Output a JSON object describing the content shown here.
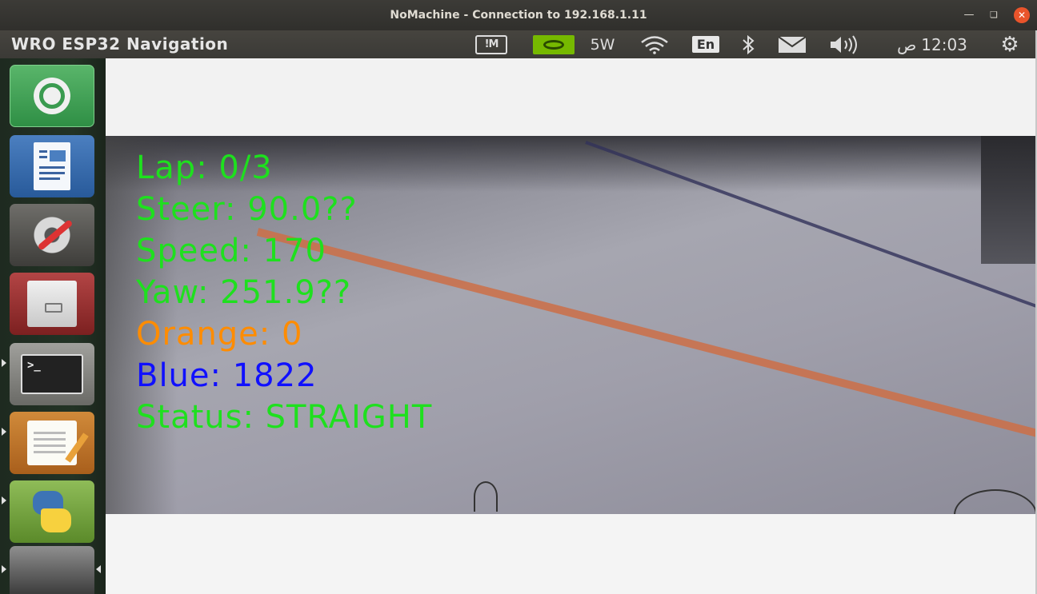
{
  "window": {
    "title": "NoMachine - Connection to 192.168.1.11",
    "minimize_icon": "minimize-icon",
    "maximize_icon": "maximize-icon",
    "close_icon": "close-icon"
  },
  "panel": {
    "app_title": "WRO ESP32 Navigation",
    "indicators": {
      "nomachine_icon": "nomachine-icon",
      "nvidia_icon": "nvidia-icon",
      "power_text": "5W",
      "wifi_icon": "wifi-icon",
      "language": "En",
      "bluetooth_icon": "bluetooth-icon",
      "mail_icon": "mail-icon",
      "volume_icon": "volume-icon",
      "clock_ampm": "ص",
      "clock_time": "12:03",
      "settings_icon": "gear-icon"
    }
  },
  "launcher": {
    "items": [
      {
        "name": "ubuntu-icon"
      },
      {
        "name": "writer-icon"
      },
      {
        "name": "system-settings-icon"
      },
      {
        "name": "file-cabinet-icon"
      },
      {
        "name": "terminal-icon",
        "glyph": ">_"
      },
      {
        "name": "text-editor-icon"
      },
      {
        "name": "python-icon"
      },
      {
        "name": "dock-icon"
      }
    ]
  },
  "camera_overlay": {
    "lap": "Lap: 0/3",
    "steer": "Steer: 90.0??",
    "speed": "Speed: 170",
    "yaw": "Yaw: 251.9??",
    "orange": "Orange: 0",
    "blue": "Blue: 1822",
    "status": "Status: STRAIGHT"
  },
  "colors": {
    "overlay_green": "#1ee01e",
    "overlay_orange": "#ff8c00",
    "overlay_blue": "#1010ff",
    "close_button": "#e9542b",
    "nvidia_green": "#76b900"
  }
}
